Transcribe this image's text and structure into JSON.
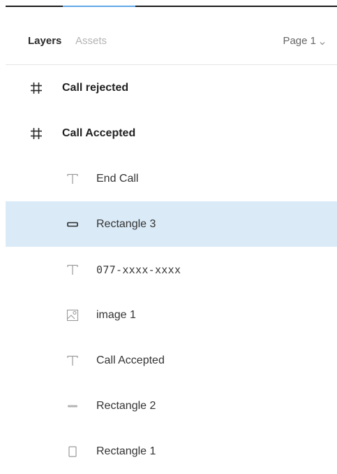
{
  "header": {
    "tab_layers": "Layers",
    "tab_assets": "Assets",
    "page_label": "Page 1"
  },
  "layers": [
    {
      "label": "Call rejected",
      "icon": "frame-icon",
      "level": 0
    },
    {
      "label": "Call Accepted",
      "icon": "frame-icon",
      "level": 0
    },
    {
      "label": "End Call",
      "icon": "text-icon",
      "level": 1
    },
    {
      "label": "Rectangle 3",
      "icon": "rectangle-icon",
      "level": 1,
      "selected": true
    },
    {
      "label": "077-xxxx-xxxx",
      "icon": "text-icon",
      "level": 1
    },
    {
      "label": "image 1",
      "icon": "image-icon",
      "level": 1
    },
    {
      "label": "Call Accepted",
      "icon": "text-icon",
      "level": 1
    },
    {
      "label": "Rectangle 2",
      "icon": "rectangle-icon",
      "level": 1
    },
    {
      "label": "Rectangle 1",
      "icon": "rectangle-icon",
      "level": 1
    }
  ],
  "colors": {
    "accent": "#5fa8e6",
    "selected_row": "#daeaf7"
  }
}
